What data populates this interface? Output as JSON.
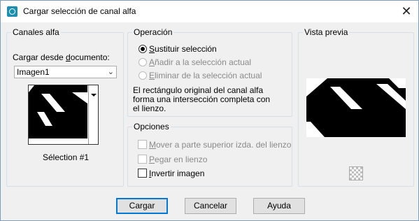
{
  "window": {
    "title": "Cargar selección de canal alfa",
    "close_glyph": "✕",
    "icon": "app-icon"
  },
  "channels": {
    "group_label": "Canales alfa",
    "source_label_pre": "Cargar desde ",
    "source_label_u": "d",
    "source_label_post": "ocumento:",
    "document_value": "Imagen1",
    "dropdown_glyph": "⌄",
    "channel_name": "Sélection #1"
  },
  "operation": {
    "group_label": "Operación",
    "options": [
      {
        "u": "S",
        "rest": "ustituir selección",
        "checked": true,
        "enabled": true
      },
      {
        "u": "A",
        "rest": "ñadir a la selección actual",
        "checked": false,
        "enabled": false
      },
      {
        "u": "E",
        "rest": "liminar de la selección actual",
        "checked": false,
        "enabled": false
      }
    ],
    "description_lines": [
      "El rectángulo original del canal alfa",
      "forma una intersección completa con",
      "el lienzo."
    ]
  },
  "options": {
    "group_label": "Opciones",
    "items": [
      {
        "u": "M",
        "rest": "over a parte superior izda. del lienzo",
        "checked": false,
        "enabled": false
      },
      {
        "u": "P",
        "rest": "egar en lienzo",
        "checked": false,
        "enabled": false
      },
      {
        "u": "I",
        "rest": "nvertir imagen",
        "checked": false,
        "enabled": true
      }
    ]
  },
  "preview": {
    "group_label": "Vista previa",
    "zoom_icon": "checkerboard-icon"
  },
  "buttons": {
    "load": "Cargar",
    "cancel": "Cancelar",
    "help": "Ayuda"
  }
}
